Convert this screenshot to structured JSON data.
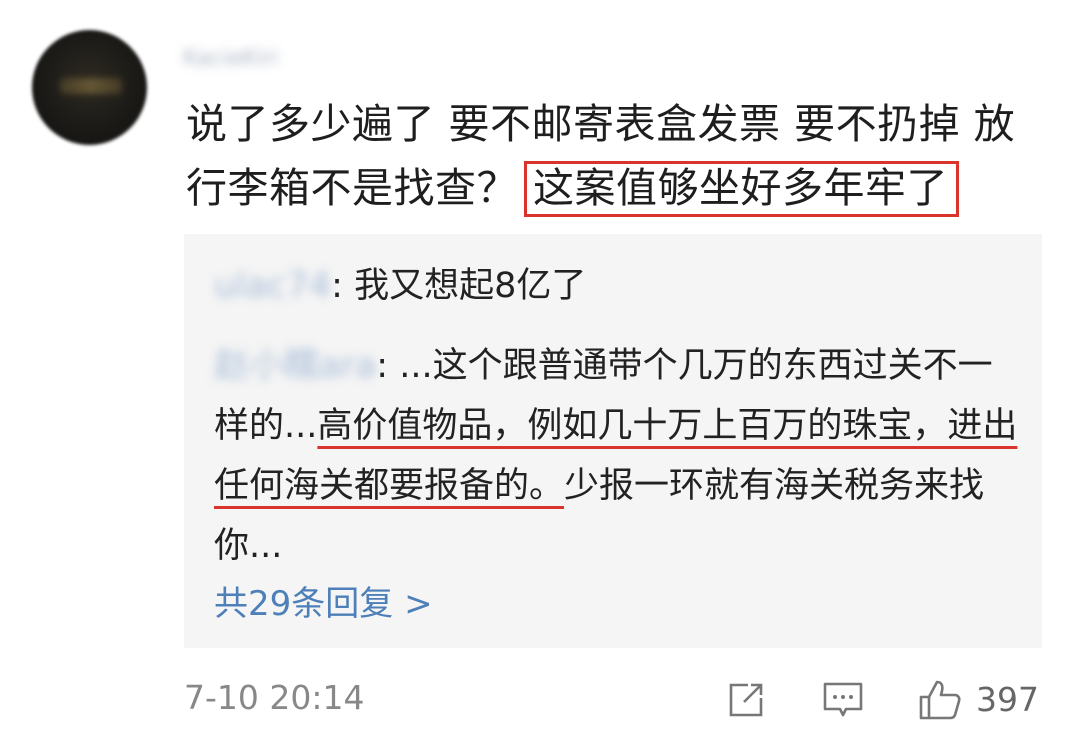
{
  "comment": {
    "username": "KacieKiri",
    "text_plain": "说了多少遍了 要不邮寄表盒发票 要不扔掉 放行李箱不是找查？",
    "text_highlighted": "这案值够坐好多年牢了"
  },
  "replies": [
    {
      "username": "ulac74",
      "separator": ":",
      "text": "我又想起8亿了"
    },
    {
      "username": "赵小糯ara",
      "separator": ":",
      "text_before": "...这个跟普通带个几万的东西过关不一样的...",
      "text_underlined": "高价值物品，例如几十万上百万的珠宝，进出任何海关都要报备的。",
      "text_after": "少报一环就有海关税务来找你..."
    }
  ],
  "more_replies": "共29条回复 >",
  "footer": {
    "timestamp": "7-10 20:14",
    "like_count": "397",
    "icons": [
      "share-icon",
      "comment-icon",
      "like-icon"
    ]
  },
  "colors": {
    "highlight": "#d9342b",
    "link": "#4d7fb8",
    "reply_background": "#f5f5f5"
  }
}
